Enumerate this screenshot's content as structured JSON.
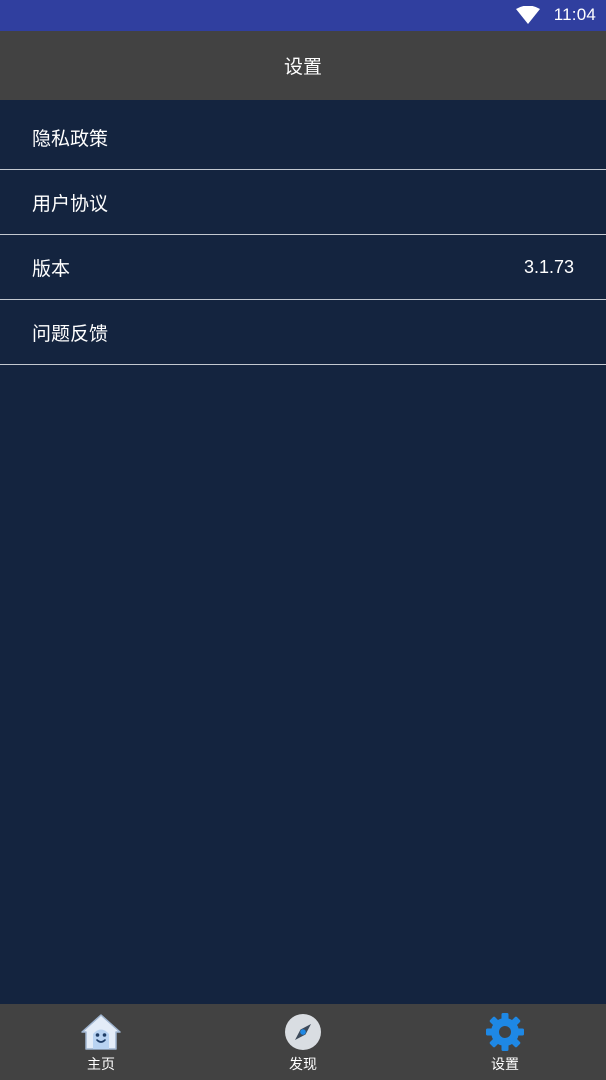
{
  "status_bar": {
    "time": "11:04",
    "wifi_icon": "wifi-icon"
  },
  "header": {
    "title": "设置"
  },
  "menu": {
    "items": [
      {
        "label": "隐私政策",
        "value": ""
      },
      {
        "label": "用户协议",
        "value": ""
      },
      {
        "label": "版本",
        "value": "3.1.73"
      },
      {
        "label": "问题反馈",
        "value": ""
      }
    ]
  },
  "tabbar": {
    "tabs": [
      {
        "label": "主页",
        "icon": "home-icon"
      },
      {
        "label": "发现",
        "icon": "compass-icon"
      },
      {
        "label": "设置",
        "icon": "gear-icon",
        "active": true
      }
    ]
  },
  "colors": {
    "status_bar": "#303f9f",
    "header": "#424242",
    "background": "#14243f",
    "active_tab_icon": "#1e88e5"
  }
}
